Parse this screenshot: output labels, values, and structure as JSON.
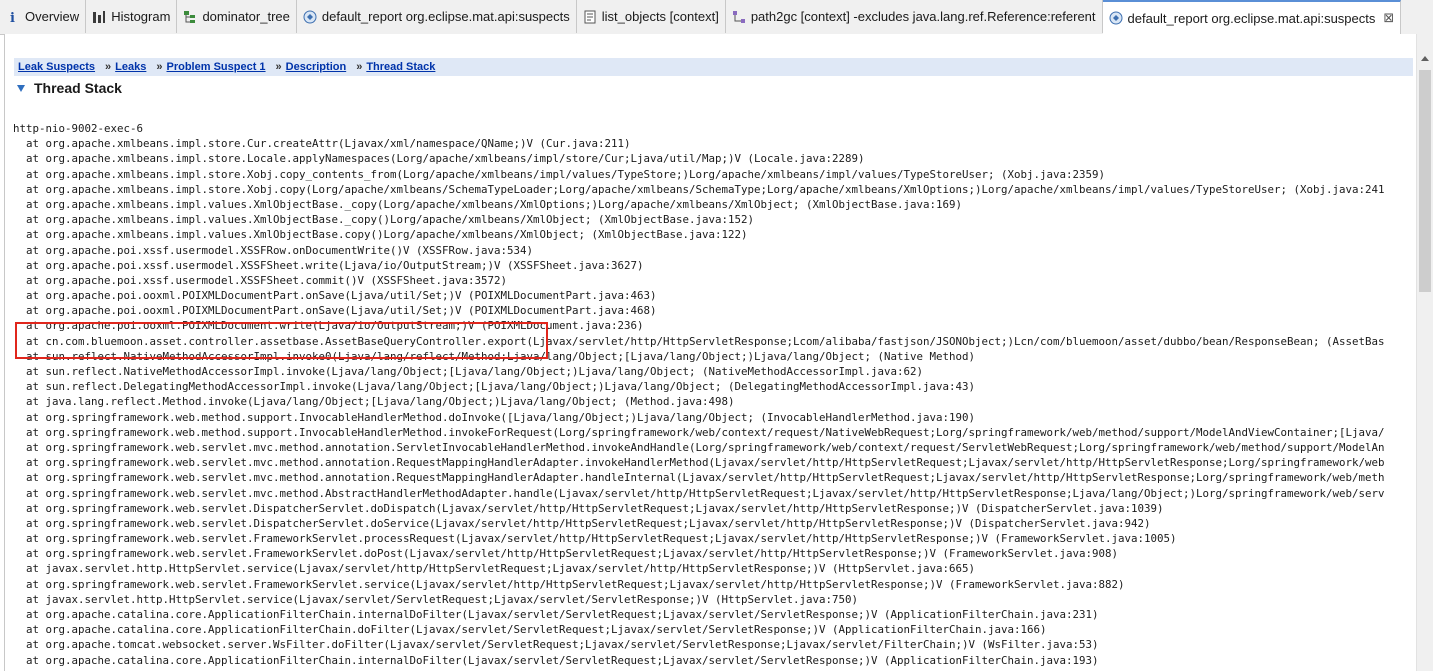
{
  "tabs": [
    {
      "label": "Overview",
      "icon": "info-icon"
    },
    {
      "label": "Histogram",
      "icon": "histogram-icon"
    },
    {
      "label": "dominator_tree",
      "icon": "tree-icon"
    },
    {
      "label": "default_report  org.eclipse.mat.api:suspects",
      "icon": "report-icon"
    },
    {
      "label": "list_objects [context]",
      "icon": "list-icon"
    },
    {
      "label": "path2gc [context] -excludes java.lang.ref.Reference:referent",
      "icon": "path-icon"
    },
    {
      "label": "default_report  org.eclipse.mat.api:suspects",
      "icon": "report-icon",
      "active": true
    }
  ],
  "close_glyph": "⊠",
  "breadcrumb": [
    {
      "label": "Leak Suspects"
    },
    {
      "label": "Leaks"
    },
    {
      "label": "Problem Suspect 1"
    },
    {
      "label": "Description"
    },
    {
      "label": "Thread Stack"
    }
  ],
  "breadcrumb_sep": "»",
  "section_title": "Thread Stack",
  "colors": {
    "accent": "#2f6fbf",
    "link": "#0033aa",
    "highlight": "#e0261c",
    "breadcrumb_bg": "#dfe8f6"
  },
  "thread_stack": [
    "http-nio-9002-exec-6",
    "  at org.apache.xmlbeans.impl.store.Cur.createAttr(Ljavax/xml/namespace/QName;)V (Cur.java:211)",
    "  at org.apache.xmlbeans.impl.store.Locale.applyNamespaces(Lorg/apache/xmlbeans/impl/store/Cur;Ljava/util/Map;)V (Locale.java:2289)",
    "  at org.apache.xmlbeans.impl.store.Xobj.copy_contents_from(Lorg/apache/xmlbeans/impl/values/TypeStore;)Lorg/apache/xmlbeans/impl/values/TypeStoreUser; (Xobj.java:2359)",
    "  at org.apache.xmlbeans.impl.store.Xobj.copy(Lorg/apache/xmlbeans/SchemaTypeLoader;Lorg/apache/xmlbeans/SchemaType;Lorg/apache/xmlbeans/XmlOptions;)Lorg/apache/xmlbeans/impl/values/TypeStoreUser; (Xobj.java:241",
    "  at org.apache.xmlbeans.impl.values.XmlObjectBase._copy(Lorg/apache/xmlbeans/XmlOptions;)Lorg/apache/xmlbeans/XmlObject; (XmlObjectBase.java:169)",
    "  at org.apache.xmlbeans.impl.values.XmlObjectBase._copy()Lorg/apache/xmlbeans/XmlObject; (XmlObjectBase.java:152)",
    "  at org.apache.xmlbeans.impl.values.XmlObjectBase.copy()Lorg/apache/xmlbeans/XmlObject; (XmlObjectBase.java:122)",
    "  at org.apache.poi.xssf.usermodel.XSSFRow.onDocumentWrite()V (XSSFRow.java:534)",
    "  at org.apache.poi.xssf.usermodel.XSSFSheet.write(Ljava/io/OutputStream;)V (XSSFSheet.java:3627)",
    "  at org.apache.poi.xssf.usermodel.XSSFSheet.commit()V (XSSFSheet.java:3572)",
    "  at org.apache.poi.ooxml.POIXMLDocumentPart.onSave(Ljava/util/Set;)V (POIXMLDocumentPart.java:463)",
    "  at org.apache.poi.ooxml.POIXMLDocumentPart.onSave(Ljava/util/Set;)V (POIXMLDocumentPart.java:468)",
    "  at org.apache.poi.ooxml.POIXMLDocument.write(Ljava/io/OutputStream;)V (POIXMLDocument.java:236)",
    "  at cn.com.bluemoon.asset.controller.assetbase.AssetBaseQueryController.export(Ljavax/servlet/http/HttpServletResponse;Lcom/alibaba/fastjson/JSONObject;)Lcn/com/bluemoon/asset/dubbo/bean/ResponseBean; (AssetBas",
    "  at sun.reflect.NativeMethodAccessorImpl.invoke0(Ljava/lang/reflect/Method;Ljava/lang/Object;[Ljava/lang/Object;)Ljava/lang/Object; (Native Method)",
    "  at sun.reflect.NativeMethodAccessorImpl.invoke(Ljava/lang/Object;[Ljava/lang/Object;)Ljava/lang/Object; (NativeMethodAccessorImpl.java:62)",
    "  at sun.reflect.DelegatingMethodAccessorImpl.invoke(Ljava/lang/Object;[Ljava/lang/Object;)Ljava/lang/Object; (DelegatingMethodAccessorImpl.java:43)",
    "  at java.lang.reflect.Method.invoke(Ljava/lang/Object;[Ljava/lang/Object;)Ljava/lang/Object; (Method.java:498)",
    "  at org.springframework.web.method.support.InvocableHandlerMethod.doInvoke([Ljava/lang/Object;)Ljava/lang/Object; (InvocableHandlerMethod.java:190)",
    "  at org.springframework.web.method.support.InvocableHandlerMethod.invokeForRequest(Lorg/springframework/web/context/request/NativeWebRequest;Lorg/springframework/web/method/support/ModelAndViewContainer;[Ljava/",
    "  at org.springframework.web.servlet.mvc.method.annotation.ServletInvocableHandlerMethod.invokeAndHandle(Lorg/springframework/web/context/request/ServletWebRequest;Lorg/springframework/web/method/support/ModelAn",
    "  at org.springframework.web.servlet.mvc.method.annotation.RequestMappingHandlerAdapter.invokeHandlerMethod(Ljavax/servlet/http/HttpServletRequest;Ljavax/servlet/http/HttpServletResponse;Lorg/springframework/web",
    "  at org.springframework.web.servlet.mvc.method.annotation.RequestMappingHandlerAdapter.handleInternal(Ljavax/servlet/http/HttpServletRequest;Ljavax/servlet/http/HttpServletResponse;Lorg/springframework/web/meth",
    "  at org.springframework.web.servlet.mvc.method.AbstractHandlerMethodAdapter.handle(Ljavax/servlet/http/HttpServletRequest;Ljavax/servlet/http/HttpServletResponse;Ljava/lang/Object;)Lorg/springframework/web/serv",
    "  at org.springframework.web.servlet.DispatcherServlet.doDispatch(Ljavax/servlet/http/HttpServletRequest;Ljavax/servlet/http/HttpServletResponse;)V (DispatcherServlet.java:1039)",
    "  at org.springframework.web.servlet.DispatcherServlet.doService(Ljavax/servlet/http/HttpServletRequest;Ljavax/servlet/http/HttpServletResponse;)V (DispatcherServlet.java:942)",
    "  at org.springframework.web.servlet.FrameworkServlet.processRequest(Ljavax/servlet/http/HttpServletRequest;Ljavax/servlet/http/HttpServletResponse;)V (FrameworkServlet.java:1005)",
    "  at org.springframework.web.servlet.FrameworkServlet.doPost(Ljavax/servlet/http/HttpServletRequest;Ljavax/servlet/http/HttpServletResponse;)V (FrameworkServlet.java:908)",
    "  at javax.servlet.http.HttpServlet.service(Ljavax/servlet/http/HttpServletRequest;Ljavax/servlet/http/HttpServletResponse;)V (HttpServlet.java:665)",
    "  at org.springframework.web.servlet.FrameworkServlet.service(Ljavax/servlet/http/HttpServletRequest;Ljavax/servlet/http/HttpServletResponse;)V (FrameworkServlet.java:882)",
    "  at javax.servlet.http.HttpServlet.service(Ljavax/servlet/ServletRequest;Ljavax/servlet/ServletResponse;)V (HttpServlet.java:750)",
    "  at org.apache.catalina.core.ApplicationFilterChain.internalDoFilter(Ljavax/servlet/ServletRequest;Ljavax/servlet/ServletResponse;)V (ApplicationFilterChain.java:231)",
    "  at org.apache.catalina.core.ApplicationFilterChain.doFilter(Ljavax/servlet/ServletRequest;Ljavax/servlet/ServletResponse;)V (ApplicationFilterChain.java:166)",
    "  at org.apache.tomcat.websocket.server.WsFilter.doFilter(Ljavax/servlet/ServletRequest;Ljavax/servlet/ServletResponse;Ljavax/servlet/FilterChain;)V (WsFilter.java:53)",
    "  at org.apache.catalina.core.ApplicationFilterChain.internalDoFilter(Ljavax/servlet/ServletRequest;Ljavax/servlet/ServletResponse;)V (ApplicationFilterChain.java:193)"
  ]
}
